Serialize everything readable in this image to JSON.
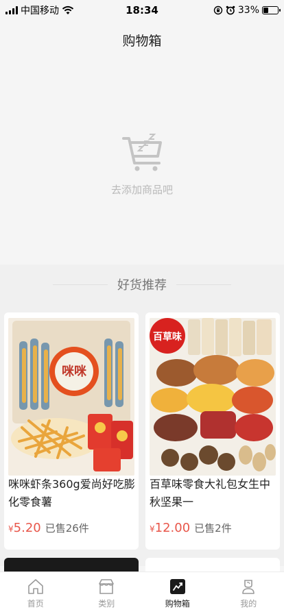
{
  "status_bar": {
    "carrier": "中国移动",
    "time": "18:34",
    "battery": "33%",
    "battery_level": 0.33
  },
  "header": {
    "title": "购物箱"
  },
  "empty_state": {
    "hint": "去添加商品吧"
  },
  "recommend": {
    "title": "好货推荐",
    "products": [
      {
        "name": "咪咪虾条360g爱尚好吃膨化零食薯",
        "currency": "¥",
        "price": "5.20",
        "sold": "已售26件"
      },
      {
        "name": "百草味零食大礼包女生中秋坚果一",
        "currency": "¥",
        "price": "12.00",
        "sold": "已售2件",
        "brand_badge": "百草味"
      }
    ]
  },
  "tabbar": {
    "items": [
      {
        "label": "首页",
        "icon": "home-icon"
      },
      {
        "label": "类别",
        "icon": "category-icon"
      },
      {
        "label": "购物箱",
        "icon": "cart-icon",
        "active": true
      },
      {
        "label": "我的",
        "icon": "profile-icon"
      }
    ]
  },
  "colors": {
    "price": "#e8564a",
    "active_tab_icon": "#1a1a1a"
  }
}
